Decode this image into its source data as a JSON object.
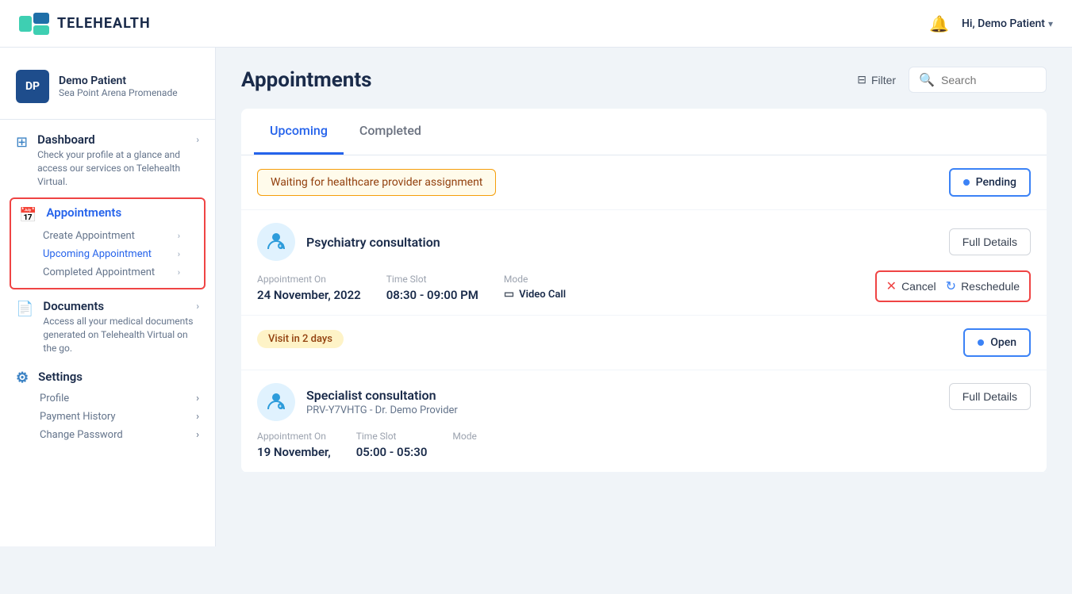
{
  "app": {
    "name": "TELEHEALTH"
  },
  "header": {
    "greeting": "Hi, Demo Patient",
    "chevron": "▾",
    "bell": "🔔",
    "filter_label": "Filter",
    "search_placeholder": "Search"
  },
  "sidebar": {
    "user": {
      "initials": "DP",
      "name": "Demo Patient",
      "address": "Sea Point Arena Promenade"
    },
    "nav": [
      {
        "id": "dashboard",
        "title": "Dashboard",
        "desc": "Check your profile at a glance and access our services on Telehealth Virtual.",
        "active": false
      },
      {
        "id": "appointments",
        "title": "Appointments",
        "active": true,
        "sub_items": [
          {
            "label": "Create Appointment",
            "active": false
          },
          {
            "label": "Upcoming Appointment",
            "active": true
          },
          {
            "label": "Completed Appointment",
            "active": false
          }
        ]
      },
      {
        "id": "documents",
        "title": "Documents",
        "desc": "Access all your medical documents generated on Telehealth Virtual on the go.",
        "active": false
      }
    ],
    "settings": {
      "title": "Settings",
      "sub_items": [
        {
          "label": "Profile"
        },
        {
          "label": "Payment History"
        },
        {
          "label": "Change Password"
        }
      ]
    }
  },
  "page": {
    "title": "Appointments",
    "tabs": [
      {
        "label": "Upcoming",
        "active": true
      },
      {
        "label": "Completed",
        "active": false
      }
    ]
  },
  "appointments": [
    {
      "id": "appt-1",
      "alert": "Waiting for healthcare provider assignment",
      "status": "Pending",
      "type": "Psychiatry consultation",
      "appointment_on_label": "Appointment On",
      "appointment_on": "24 November, 2022",
      "time_slot_label": "Time Slot",
      "time_slot": "08:30 - 09:00 PM",
      "mode_label": "Mode",
      "mode": "Video Call",
      "actions": [
        "Cancel",
        "Reschedule"
      ]
    },
    {
      "id": "appt-2",
      "visit_badge": "Visit in 2 days",
      "status": "Open",
      "type": "Specialist consultation",
      "provider": "PRV-Y7VHTG - Dr. Demo Provider",
      "appointment_on_label": "Appointment On",
      "appointment_on": "19 November,",
      "time_slot_label": "Time Slot",
      "time_slot": "05:00 - 05:30",
      "mode_label": "Mode",
      "mode": ""
    }
  ],
  "icons": {
    "filter": "⊟",
    "search": "🔍",
    "video": "▭",
    "cancel_x": "✕",
    "reschedule": "↻",
    "chevron_right": "›"
  }
}
